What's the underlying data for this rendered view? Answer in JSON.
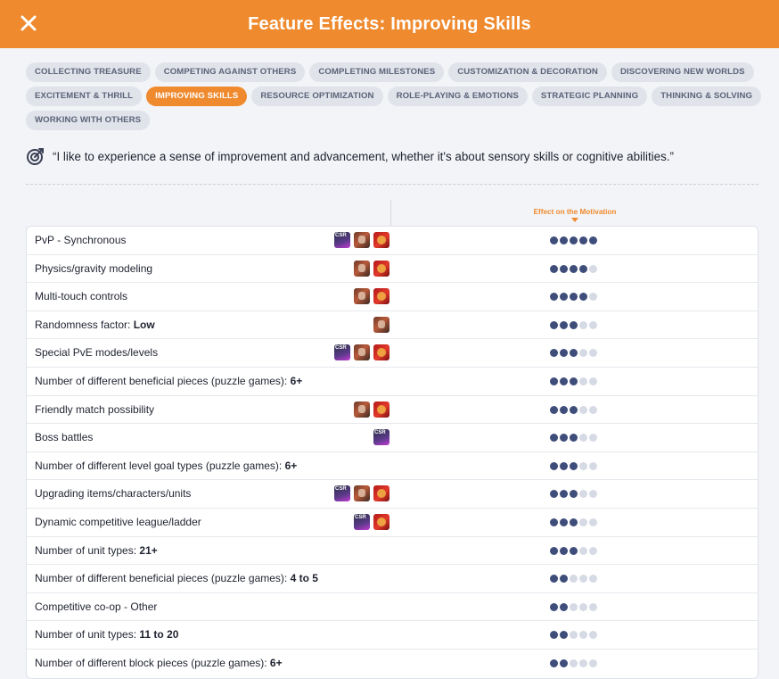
{
  "header": {
    "title": "Feature Effects: Improving Skills",
    "close_icon": "close-icon"
  },
  "tags": [
    {
      "label": "COLLECTING TREASURE",
      "active": false
    },
    {
      "label": "COMPETING AGAINST OTHERS",
      "active": false
    },
    {
      "label": "COMPLETING MILESTONES",
      "active": false
    },
    {
      "label": "CUSTOMIZATION & DECORATION",
      "active": false
    },
    {
      "label": "DISCOVERING NEW WORLDS",
      "active": false
    },
    {
      "label": "EXCITEMENT & THRILL",
      "active": false
    },
    {
      "label": "IMPROVING SKILLS",
      "active": true
    },
    {
      "label": "RESOURCE OPTIMIZATION",
      "active": false
    },
    {
      "label": "ROLE-PLAYING & EMOTIONS",
      "active": false
    },
    {
      "label": "STRATEGIC PLANNING",
      "active": false
    },
    {
      "label": "THINKING & SOLVING",
      "active": false
    },
    {
      "label": "WORKING WITH OTHERS",
      "active": false
    }
  ],
  "quote": {
    "icon": "target-icon",
    "text": "“I like to experience a sense of improvement and advancement, whether it's about sensory skills or cognitive abilities.”"
  },
  "table": {
    "column_header": "Effect on the Motivation",
    "rows": [
      {
        "label": "PvP - Synchronous",
        "value": "",
        "icons": [
          "csr",
          "war",
          "red"
        ],
        "rating": 5
      },
      {
        "label": "Physics/gravity modeling",
        "value": "",
        "icons": [
          "war",
          "red"
        ],
        "rating": 4
      },
      {
        "label": "Multi-touch controls",
        "value": "",
        "icons": [
          "war",
          "red"
        ],
        "rating": 4
      },
      {
        "label": "Randomness factor: ",
        "value": "Low",
        "icons": [
          "war"
        ],
        "rating": 3
      },
      {
        "label": "Special PvE modes/levels",
        "value": "",
        "icons": [
          "csr",
          "war",
          "red"
        ],
        "rating": 3
      },
      {
        "label": "Number of different beneficial pieces (puzzle games): ",
        "value": "6+",
        "icons": [],
        "rating": 3
      },
      {
        "label": "Friendly match possibility",
        "value": "",
        "icons": [
          "war",
          "red"
        ],
        "rating": 3
      },
      {
        "label": "Boss battles",
        "value": "",
        "icons": [
          "csr"
        ],
        "rating": 3
      },
      {
        "label": "Number of different level goal types (puzzle games): ",
        "value": "6+",
        "icons": [],
        "rating": 3
      },
      {
        "label": "Upgrading items/characters/units",
        "value": "",
        "icons": [
          "csr",
          "war",
          "red"
        ],
        "rating": 3
      },
      {
        "label": "Dynamic competitive league/ladder",
        "value": "",
        "icons": [
          "csr",
          "red"
        ],
        "rating": 3
      },
      {
        "label": "Number of unit types: ",
        "value": "21+",
        "icons": [],
        "rating": 3
      },
      {
        "label": "Number of different beneficial pieces (puzzle games): ",
        "value": "4 to 5",
        "icons": [],
        "rating": 2
      },
      {
        "label": "Competitive co-op - Other",
        "value": "",
        "icons": [],
        "rating": 2
      },
      {
        "label": "Number of unit types: ",
        "value": "11 to 20",
        "icons": [],
        "rating": 2
      },
      {
        "label": "Number of different block pieces (puzzle games): ",
        "value": "6+",
        "icons": [],
        "rating": 2
      }
    ]
  }
}
